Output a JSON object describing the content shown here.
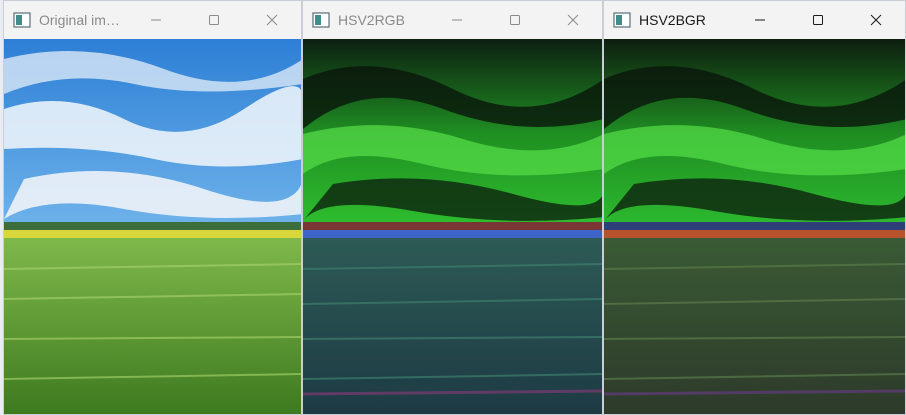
{
  "windows": [
    {
      "id": "original",
      "title": "Original im…",
      "state": "inactive",
      "palette": {
        "sky_top": "#2d7fd6",
        "sky_mid": "#6fb3ea",
        "cloud": "#f4f8fc",
        "horizon": "#c9d7e3",
        "yellow": "#d8d63a",
        "field_top": "#7fb84a",
        "field_bottom": "#3d7a1f",
        "grass_streak": "#a9d46e"
      }
    },
    {
      "id": "hsv2rgb",
      "title": "HSV2RGB",
      "state": "inactive",
      "palette": {
        "sky_top": "#0d1f12",
        "sky_mid": "#2fbf2f",
        "cloud": "#58e04a",
        "horizon": "#101a14",
        "yellow": "#3d64c7",
        "field_top": "#2d5a55",
        "field_bottom": "#1d3a44",
        "grass_streak": "#3f7d6e"
      }
    },
    {
      "id": "hsv2bgr",
      "title": "HSV2BGR",
      "state": "active",
      "palette": {
        "sky_top": "#0e1e0f",
        "sky_mid": "#2dbb2f",
        "cloud": "#55df48",
        "horizon": "#0f190f",
        "yellow": "#b6532c",
        "field_top": "#3a5a35",
        "field_bottom": "#2d3a2a",
        "grass_streak": "#5a7a4a"
      }
    }
  ],
  "controls": {
    "minimize_icon": "minimize-icon",
    "maximize_icon": "maximize-icon",
    "close_icon": "close-icon"
  }
}
